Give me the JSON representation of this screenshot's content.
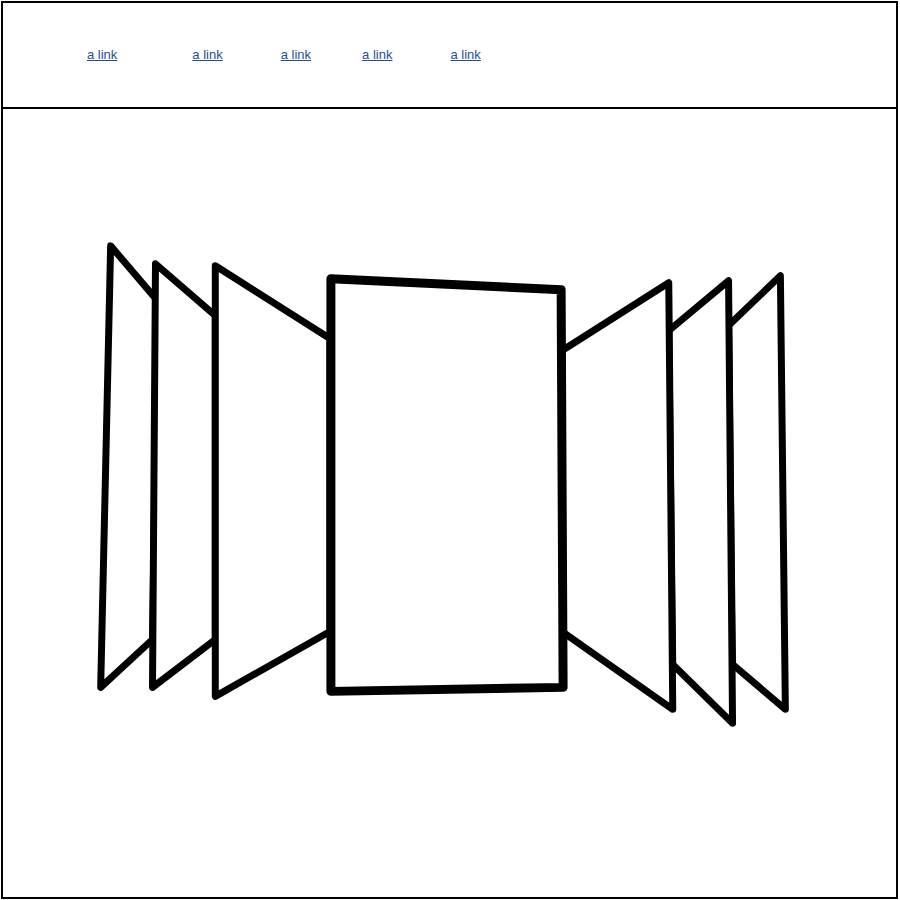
{
  "nav": {
    "links": [
      {
        "label": "a link"
      },
      {
        "label": "a link"
      },
      {
        "label": "a link"
      },
      {
        "label": "a link"
      },
      {
        "label": "a link"
      }
    ]
  },
  "carousel": {
    "slides": [
      {
        "selected": false
      },
      {
        "selected": false
      },
      {
        "selected": false
      },
      {
        "selected": true
      },
      {
        "selected": false
      },
      {
        "selected": false
      },
      {
        "selected": false
      }
    ]
  }
}
